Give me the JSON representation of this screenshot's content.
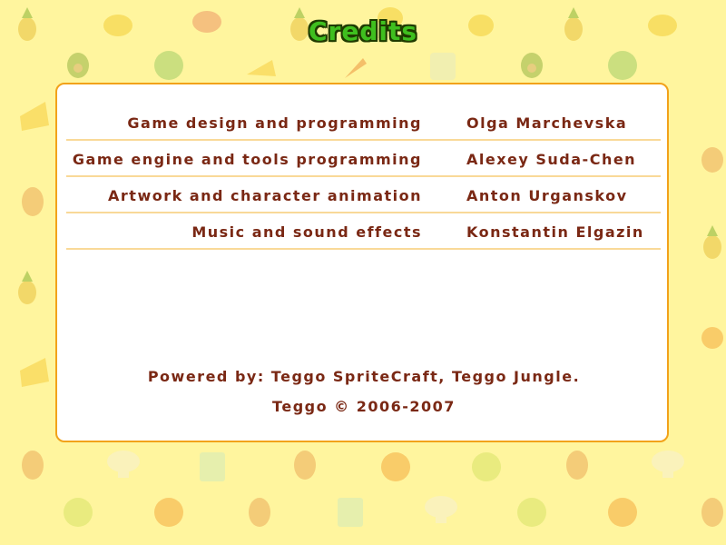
{
  "screen": {
    "title": "Credits"
  },
  "credits": [
    {
      "role": "Game design and programming",
      "name": "Olga Marchevska"
    },
    {
      "role": "Game engine and tools programming",
      "name": "Alexey Suda-Chen"
    },
    {
      "role": "Artwork and character animation",
      "name": "Anton Urganskov"
    },
    {
      "role": "Music and sound effects",
      "name": "Konstantin Elgazin"
    }
  ],
  "footer": {
    "powered_by": "Powered by: Teggo SpriteCraft, Teggo Jungle.",
    "copyright": "Teggo © 2006-2007"
  },
  "background_icons": [
    "pineapple-icon",
    "lemon-icon",
    "steak-icon",
    "avocado-icon",
    "cabbage-icon",
    "cheese-icon",
    "carrot-icon",
    "flour-icon",
    "drumstick-icon",
    "orange-icon",
    "lime-icon",
    "mushroom-icon",
    "milk-icon"
  ],
  "colors": {
    "background": "#fff59e",
    "panel": "#ffffff",
    "panel_border": "#f2a21a",
    "text": "#7a2814",
    "title": "#3fbf1f",
    "row_line": "#f9d998"
  }
}
